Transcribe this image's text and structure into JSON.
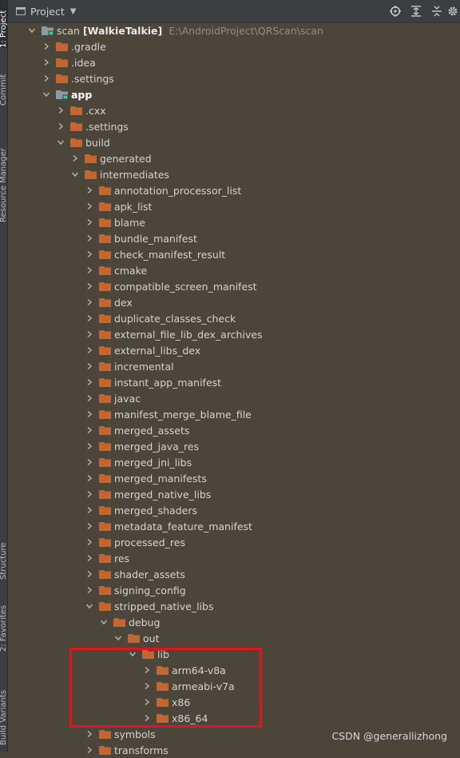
{
  "side_tabs": [
    {
      "label": "1: Project",
      "active": true
    },
    {
      "label": "Commit",
      "active": false
    },
    {
      "label": "Resource Manager",
      "active": false
    },
    {
      "label": "Structure",
      "active": false
    },
    {
      "label": "2: Favorites",
      "active": false
    },
    {
      "label": "Build Variants",
      "active": false
    }
  ],
  "header": {
    "title": "Project",
    "tools": [
      "locate-icon",
      "expand-all-icon",
      "collapse-all-icon",
      "gear-icon"
    ]
  },
  "root": {
    "name": "scan",
    "module": "[WalkieTalkie]",
    "path": "E:\\AndroidProject\\QRScan\\scan"
  },
  "tree": [
    {
      "label": "scan",
      "depth": 0,
      "expanded": true,
      "icon": "module-folder"
    },
    {
      "label": ".gradle",
      "depth": 1,
      "expanded": false,
      "icon": "folder"
    },
    {
      "label": ".idea",
      "depth": 1,
      "expanded": false,
      "icon": "folder"
    },
    {
      "label": ".settings",
      "depth": 1,
      "expanded": false,
      "icon": "folder"
    },
    {
      "label": "app",
      "depth": 1,
      "expanded": true,
      "icon": "module-folder",
      "bold": true
    },
    {
      "label": ".cxx",
      "depth": 2,
      "expanded": false,
      "icon": "folder"
    },
    {
      "label": ".settings",
      "depth": 2,
      "expanded": false,
      "icon": "folder"
    },
    {
      "label": "build",
      "depth": 2,
      "expanded": true,
      "icon": "folder"
    },
    {
      "label": "generated",
      "depth": 3,
      "expanded": false,
      "icon": "folder"
    },
    {
      "label": "intermediates",
      "depth": 3,
      "expanded": true,
      "icon": "folder"
    },
    {
      "label": "annotation_processor_list",
      "depth": 4,
      "expanded": false,
      "icon": "folder"
    },
    {
      "label": "apk_list",
      "depth": 4,
      "expanded": false,
      "icon": "folder"
    },
    {
      "label": "blame",
      "depth": 4,
      "expanded": false,
      "icon": "folder"
    },
    {
      "label": "bundle_manifest",
      "depth": 4,
      "expanded": false,
      "icon": "folder"
    },
    {
      "label": "check_manifest_result",
      "depth": 4,
      "expanded": false,
      "icon": "folder"
    },
    {
      "label": "cmake",
      "depth": 4,
      "expanded": false,
      "icon": "folder"
    },
    {
      "label": "compatible_screen_manifest",
      "depth": 4,
      "expanded": false,
      "icon": "folder"
    },
    {
      "label": "dex",
      "depth": 4,
      "expanded": false,
      "icon": "folder"
    },
    {
      "label": "duplicate_classes_check",
      "depth": 4,
      "expanded": false,
      "icon": "folder"
    },
    {
      "label": "external_file_lib_dex_archives",
      "depth": 4,
      "expanded": false,
      "icon": "folder"
    },
    {
      "label": "external_libs_dex",
      "depth": 4,
      "expanded": false,
      "icon": "folder"
    },
    {
      "label": "incremental",
      "depth": 4,
      "expanded": false,
      "icon": "folder"
    },
    {
      "label": "instant_app_manifest",
      "depth": 4,
      "expanded": false,
      "icon": "folder"
    },
    {
      "label": "javac",
      "depth": 4,
      "expanded": false,
      "icon": "folder"
    },
    {
      "label": "manifest_merge_blame_file",
      "depth": 4,
      "expanded": false,
      "icon": "folder"
    },
    {
      "label": "merged_assets",
      "depth": 4,
      "expanded": false,
      "icon": "folder"
    },
    {
      "label": "merged_java_res",
      "depth": 4,
      "expanded": false,
      "icon": "folder"
    },
    {
      "label": "merged_jni_libs",
      "depth": 4,
      "expanded": false,
      "icon": "folder"
    },
    {
      "label": "merged_manifests",
      "depth": 4,
      "expanded": false,
      "icon": "folder"
    },
    {
      "label": "merged_native_libs",
      "depth": 4,
      "expanded": false,
      "icon": "folder"
    },
    {
      "label": "merged_shaders",
      "depth": 4,
      "expanded": false,
      "icon": "folder"
    },
    {
      "label": "metadata_feature_manifest",
      "depth": 4,
      "expanded": false,
      "icon": "folder"
    },
    {
      "label": "processed_res",
      "depth": 4,
      "expanded": false,
      "icon": "folder"
    },
    {
      "label": "res",
      "depth": 4,
      "expanded": false,
      "icon": "folder"
    },
    {
      "label": "shader_assets",
      "depth": 4,
      "expanded": false,
      "icon": "folder"
    },
    {
      "label": "signing_config",
      "depth": 4,
      "expanded": false,
      "icon": "folder"
    },
    {
      "label": "stripped_native_libs",
      "depth": 4,
      "expanded": true,
      "icon": "folder"
    },
    {
      "label": "debug",
      "depth": 5,
      "expanded": true,
      "icon": "folder"
    },
    {
      "label": "out",
      "depth": 6,
      "expanded": true,
      "icon": "folder"
    },
    {
      "label": "lib",
      "depth": 7,
      "expanded": true,
      "icon": "folder"
    },
    {
      "label": "arm64-v8a",
      "depth": 8,
      "expanded": false,
      "icon": "folder"
    },
    {
      "label": "armeabi-v7a",
      "depth": 8,
      "expanded": false,
      "icon": "folder"
    },
    {
      "label": "x86",
      "depth": 8,
      "expanded": false,
      "icon": "folder"
    },
    {
      "label": "x86_64",
      "depth": 8,
      "expanded": false,
      "icon": "folder"
    },
    {
      "label": "symbols",
      "depth": 4,
      "expanded": false,
      "icon": "folder"
    },
    {
      "label": "transforms",
      "depth": 4,
      "expanded": false,
      "icon": "folder"
    }
  ],
  "colors": {
    "folder": "#c4662f",
    "module_badge": "#3ec3a3",
    "highlight": "#e0141e"
  },
  "watermark": "CSDN @generallizhong"
}
